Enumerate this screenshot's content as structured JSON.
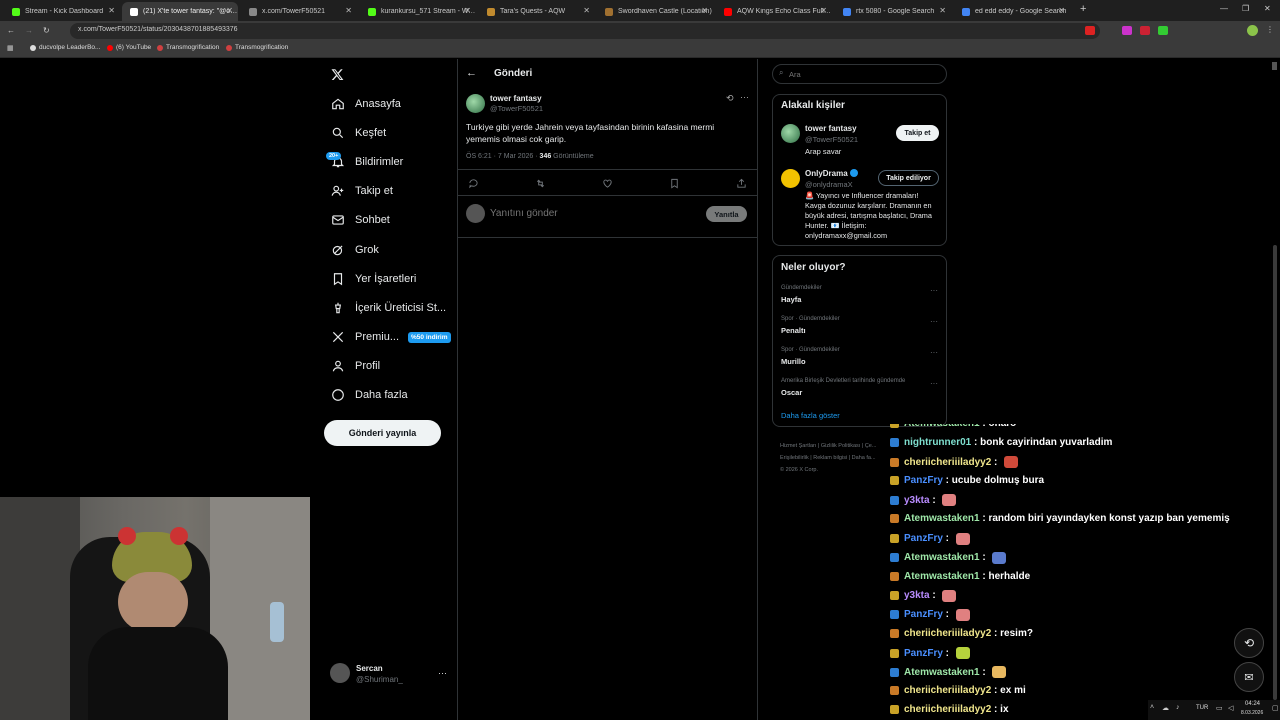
{
  "browser": {
    "tabs": [
      {
        "title": "Stream - Kick Dashboard",
        "color": "#53fc18"
      },
      {
        "title": "(21) X'te tower fantasy: \"@only",
        "color": "#ffffff"
      },
      {
        "title": "x.com/TowerF50521",
        "color": "#888888"
      },
      {
        "title": "kurankursu_571 Stream - Watch",
        "color": "#53fc18"
      },
      {
        "title": "Tara's Quests - AQW",
        "color": "#c08a2e"
      },
      {
        "title": "Swordhaven Castle (Location)",
        "color": "#a07030"
      },
      {
        "title": "AQW Kings Echo Class Full Walk",
        "color": "#ff0000"
      },
      {
        "title": "rtx 5080 - Google Search",
        "color": "#4285f4"
      },
      {
        "title": "ed edd eddy - Google Search",
        "color": "#4285f4"
      }
    ],
    "new_tab": "+",
    "url": "x.com/TowerF50521/status/2030438701885493376",
    "bookmarks": [
      {
        "label": "ducvolpe LeaderBo...",
        "color": "#dddddd"
      },
      {
        "label": "(6) YouTube",
        "color": "#ff0000"
      },
      {
        "label": "Transmogrification",
        "color": "#d04040"
      },
      {
        "label": "Transmogrification",
        "color": "#d04040"
      }
    ]
  },
  "sidebar": {
    "items": [
      {
        "label": "Anasayfa",
        "icon": "home-icon"
      },
      {
        "label": "Keşfet",
        "icon": "search-icon"
      },
      {
        "label": "Bildirimler",
        "icon": "bell-icon",
        "badge": "20+"
      },
      {
        "label": "Takip et",
        "icon": "follow-icon"
      },
      {
        "label": "Sohbet",
        "icon": "mail-icon"
      },
      {
        "label": "Grok",
        "icon": "grok-icon"
      },
      {
        "label": "Yer İşaretleri",
        "icon": "bookmark-icon"
      },
      {
        "label": "İçerik Üreticisi St...",
        "icon": "creator-icon"
      },
      {
        "label": "Premiu...",
        "icon": "x-icon",
        "badge": "%50 indirim"
      },
      {
        "label": "Profil",
        "icon": "profile-icon"
      },
      {
        "label": "Daha fazla",
        "icon": "more-icon"
      }
    ],
    "post_button": "Gönderi yayınla",
    "account": {
      "name": "Sercan",
      "handle": "@Shuriman_",
      "more": "···"
    }
  },
  "post": {
    "header": "Gönderi",
    "author": "tower fantasy",
    "handle": "@TowerF50521",
    "text": "Turkiye gibi yerde Jahrein veya tayfasindan birinin kafasina mermi yememis olmasi cok garip.",
    "time": "ÖS 6:21 · 7 Mar 2026 · ",
    "views_count": "346",
    "views_label": " Görüntüleme",
    "reply_placeholder": "Yanıtını gönder",
    "reply_button": "Yanıtla"
  },
  "right": {
    "search_placeholder": "Ara",
    "related_title": "Alakalı kişiler",
    "people": [
      {
        "name": "tower fantasy",
        "handle": "@TowerF50521",
        "bio": "Arap savar",
        "button": "Takip et"
      },
      {
        "name": "OnlyDrama",
        "handle": "@onlydramaX",
        "bio": "🚨 Yayıncı ve Influencer dramaları! Kavga dozunuz karşılarır. Dramanın en büyük adresi, tartışma başlatıcı, Drama Hunter. 📧 İletişim: onlydramaxx@gmail.com",
        "button": "Takip ediliyor"
      }
    ],
    "trends_title": "Neler oluyor?",
    "trends": [
      {
        "context": "Gündemdekiler",
        "name": "Hayfa"
      },
      {
        "context": "Spor · Gündemdekiler",
        "name": "Penaltı"
      },
      {
        "context": "Spor · Gündemdekiler",
        "name": "Murillo"
      },
      {
        "context": "Amerika Birleşik Devletleri tarihinde gündemde",
        "name": "Oscar"
      }
    ],
    "show_more": "Daha fazla göster",
    "footer": [
      "Hizmet Şartları",
      "Gizlilik Politikası",
      "Çe...",
      "Erişilebilirlik",
      "Reklam bilgisi",
      "Daha fa...",
      "© 2026 X Corp."
    ]
  },
  "chat": [
    {
      "user": "Atemwastaken1",
      "msg": " : onaro",
      "color": "#9ee6a8"
    },
    {
      "user": "nightrunner01",
      "msg": " : bonk cayirindan yuvarladim",
      "color": "#7fe0d0"
    },
    {
      "user": "cheriicheriiiladyy2",
      "msg": " : ",
      "color": "#f0e68c",
      "emote": "#d04a3a"
    },
    {
      "user": "PanzFry",
      "msg": " : ucube dolmuş bura",
      "color": "#4a8fff"
    },
    {
      "user": "y3kta",
      "msg": " : ",
      "color": "#b98cff",
      "emote": "#e08080"
    },
    {
      "user": "Atemwastaken1",
      "msg": " : random biri yayındayken konst yazıp ban yememiş",
      "color": "#9ee6a8"
    },
    {
      "user": "PanzFry",
      "msg": " : ",
      "color": "#4a8fff",
      "emote": "#e08080"
    },
    {
      "user": "Atemwastaken1",
      "msg": " : ",
      "color": "#9ee6a8",
      "emote": "#5a7acc"
    },
    {
      "user": "Atemwastaken1",
      "msg": " : herhalde",
      "color": "#9ee6a8"
    },
    {
      "user": "y3kta",
      "msg": " : ",
      "color": "#b98cff",
      "emote": "#e08080"
    },
    {
      "user": "PanzFry",
      "msg": " : ",
      "color": "#4a8fff",
      "emote": "#e08080"
    },
    {
      "user": "cheriicheriiiladyy2",
      "msg": " : resim?",
      "color": "#f0e68c"
    },
    {
      "user": "PanzFry",
      "msg": " : ",
      "color": "#4a8fff",
      "emote": "#b6d23c"
    },
    {
      "user": "Atemwastaken1",
      "msg": " : ",
      "color": "#9ee6a8",
      "emote": "#e8b860"
    },
    {
      "user": "cheriicheriiiladyy2",
      "msg": " : ex mi",
      "color": "#f0e68c"
    },
    {
      "user": "cheriicheriiiladyy2",
      "msg": " : ix",
      "color": "#f0e68c"
    }
  ],
  "taskbar": {
    "lang": "TUR",
    "time": "04:24",
    "date": "8.03.2026"
  }
}
